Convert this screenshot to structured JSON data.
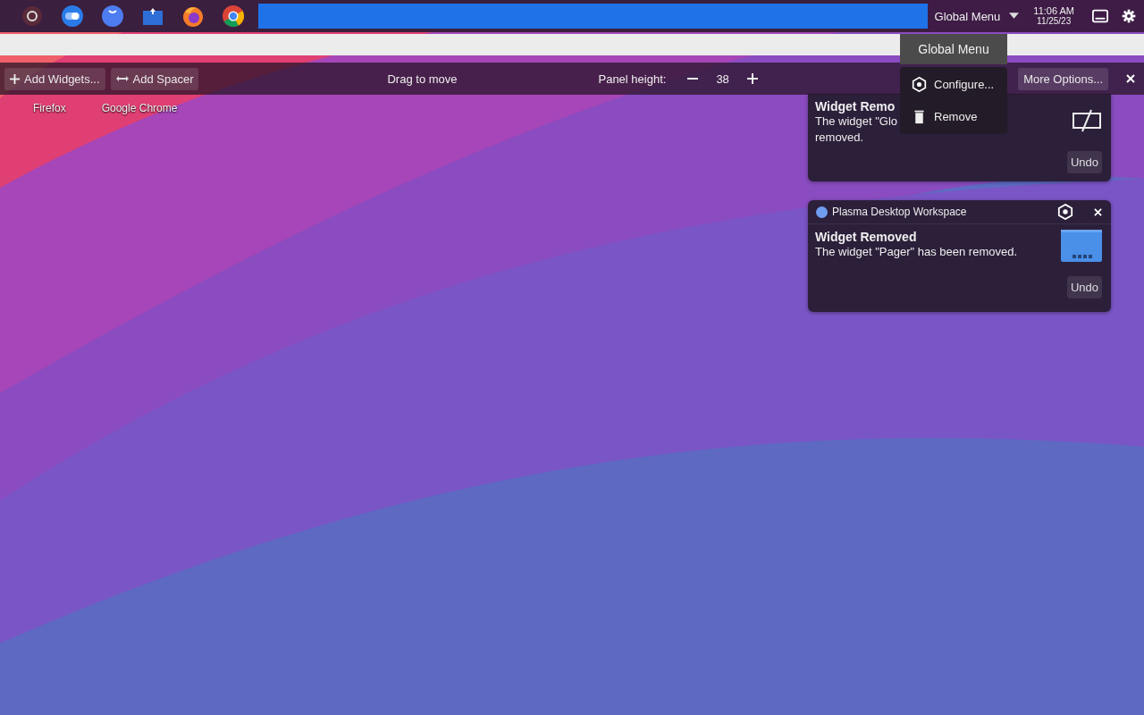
{
  "top_panel": {
    "global_menu": "Global Menu",
    "clock": {
      "time": "11:06 AM",
      "date": "11/25/23"
    }
  },
  "tooltip": "Global Menu",
  "panel_toolbar": {
    "add_widgets": "Add Widgets...",
    "add_spacer": "Add Spacer",
    "drag_hint": "Drag to move",
    "height_label": "Panel height:",
    "height_value": "38",
    "more_options": "More Options..."
  },
  "desktop_icons": [
    {
      "label": "Firefox"
    },
    {
      "label": "Google Chrome"
    }
  ],
  "notifications": [
    {
      "kind": "file",
      "title": "Widget Remo",
      "body_lines": [
        "The widget \"Glo",
        "removed."
      ],
      "action": "Undo"
    },
    {
      "kind": "pager",
      "app": "Plasma Desktop Workspace",
      "title": "Widget Removed",
      "body_lines": [
        "The widget \"Pager\" has been removed."
      ],
      "action": "Undo"
    }
  ],
  "context_menu": [
    {
      "label": "Configure...",
      "kind": "configure"
    },
    {
      "label": "Remove",
      "kind": "remove"
    }
  ]
}
